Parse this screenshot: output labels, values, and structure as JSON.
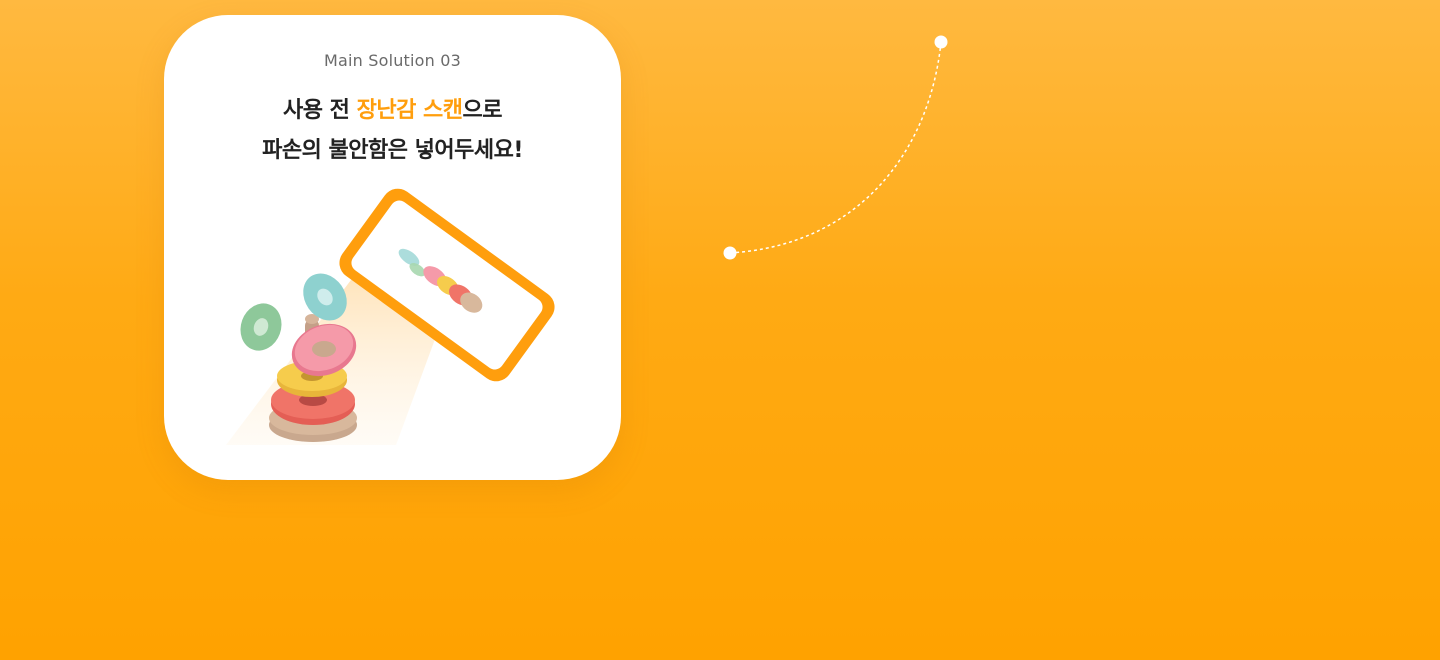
{
  "card": {
    "label": "Main Solution 03",
    "title_line1_pre": "사용 전 ",
    "title_line1_highlight": "장난감 스캔",
    "title_line1_post": "으로",
    "title_line2": "파손의 불안함은 넣어두세요!"
  },
  "colors": {
    "background_top": "#FFB940",
    "background_bottom": "#FFA200",
    "highlight": "#FF9E0D",
    "phone_frame": "#FF9E0D",
    "title_text": "#222222",
    "label_text": "#6a6a6a"
  },
  "icons": {
    "phone": "smartphone-icon",
    "toy": "stacking-rings-toy-icon",
    "connector": "dotted-curve-connector"
  }
}
